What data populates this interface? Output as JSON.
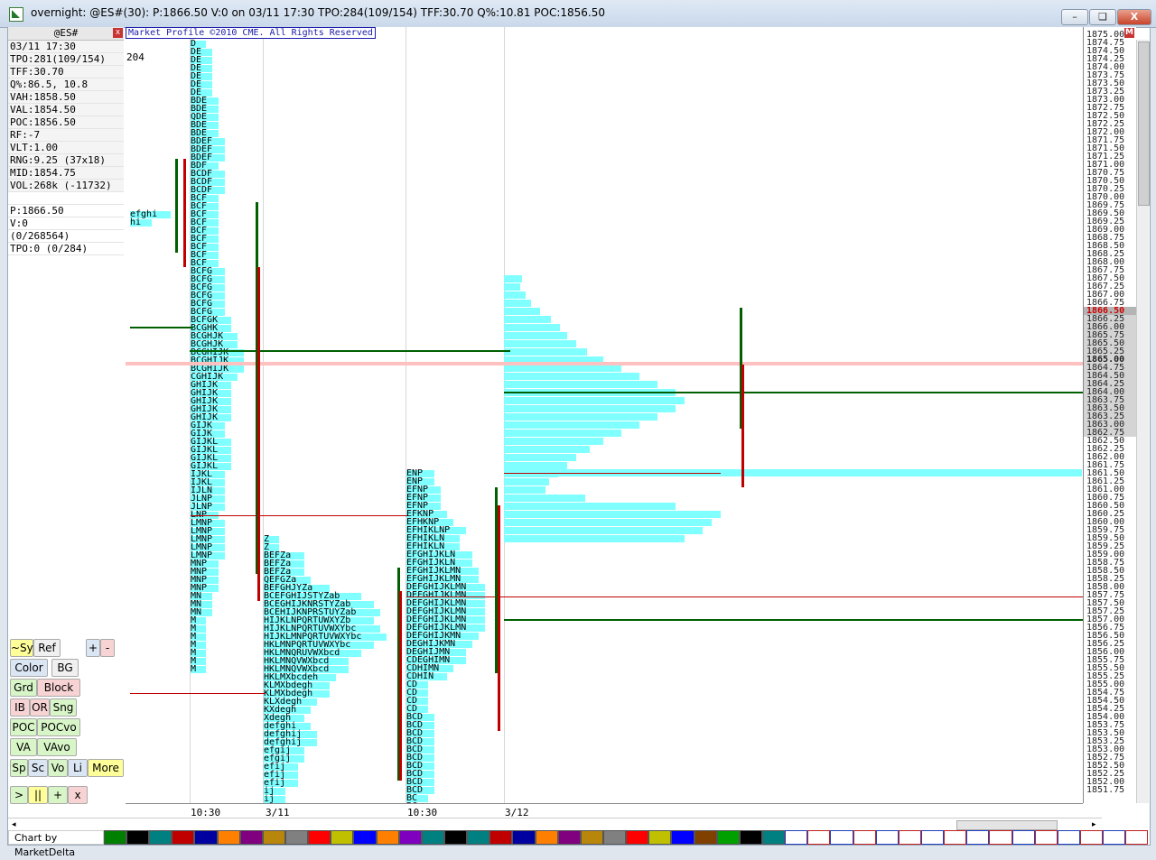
{
  "window": {
    "title": "overnight: @ES#(30): P:1866.50 V:0 on 03/11 17:30 TPO:284(109/154) TFF:30.70 Q%:10.81 POC:1856.50",
    "minimize": "–",
    "restore": "❏",
    "close": "X"
  },
  "info_panel": {
    "symbol": "@ES#",
    "close_mark": "x",
    "rows": [
      "03/11 17:30",
      "TPO:281(109/154)",
      "TFF:30.70",
      " Q%:86.5, 10.8",
      "VAH:1858.50",
      "VAL:1854.50",
      "POC:1856.50",
      "  RF:-7",
      "VLT:1.00",
      "RNG:9.25 (37x18)",
      "MID:1854.75",
      "VOL:268k (-11732)",
      "",
      "    P:1866.50",
      "   V:0",
      "     (0/268564)",
      "TPO:0 (0/284)"
    ],
    "tpo_overflow": "204"
  },
  "chart": {
    "copyright": "Market Profile ©2010 CME. All Rights Reserved",
    "right_mark": "M",
    "time_labels": [
      "10:30",
      "3/11",
      "10:30",
      "3/12"
    ],
    "current_price": "1866.50",
    "last_price_row": "1865.00",
    "price_ticks": [
      "1875.00",
      "1874.75",
      "1874.50",
      "1874.25",
      "1874.00",
      "1873.75",
      "1873.50",
      "1873.25",
      "1873.00",
      "1872.75",
      "1872.50",
      "1872.25",
      "1872.00",
      "1871.75",
      "1871.50",
      "1871.25",
      "1871.00",
      "1870.75",
      "1870.50",
      "1870.25",
      "1870.00",
      "1869.75",
      "1869.50",
      "1869.25",
      "1869.00",
      "1868.75",
      "1868.50",
      "1868.25",
      "1868.00",
      "1867.75",
      "1867.50",
      "1867.25",
      "1867.00",
      "1866.75",
      "1866.50",
      "1866.25",
      "1866.00",
      "1865.75",
      "1865.50",
      "1865.25",
      "1865.00",
      "1864.75",
      "1864.50",
      "1864.25",
      "1864.00",
      "1863.75",
      "1863.50",
      "1863.25",
      "1863.00",
      "1862.75",
      "1862.50",
      "1862.25",
      "1862.00",
      "1861.75",
      "1861.50",
      "1861.25",
      "1861.00",
      "1860.75",
      "1860.50",
      "1860.25",
      "1860.00",
      "1859.75",
      "1859.50",
      "1859.25",
      "1859.00",
      "1858.75",
      "1858.50",
      "1858.25",
      "1858.00",
      "1857.75",
      "1857.50",
      "1857.25",
      "1857.00",
      "1856.75",
      "1856.50",
      "1856.25",
      "1856.00",
      "1855.75",
      "1855.50",
      "1855.25",
      "1855.00",
      "1854.75",
      "1854.50",
      "1854.25",
      "1854.00",
      "1853.75",
      "1853.50",
      "1853.25",
      "1853.00",
      "1852.75",
      "1852.50",
      "1852.25",
      "1852.00",
      "1851.75"
    ],
    "profiles": [
      {
        "name": "profile-0310-night",
        "rows": [
          "efghi",
          "hi"
        ]
      },
      {
        "name": "profile-0310-day",
        "rows": [
          "D",
          "DE",
          "DE",
          "DE",
          "DE",
          "DE",
          "DE",
          "BDE",
          "BDE",
          "QDE",
          "BDE",
          "BDE",
          "BDEF",
          "BDEF",
          "BDEF",
          "BDF",
          "BCDF",
          "BCDF",
          "BCDF",
          "BCF",
          "BCF",
          "BCF",
          "BCF",
          "BCF",
          "BCF",
          "BCF",
          "BCF",
          "BCF",
          "BCFG",
          "BCFG",
          "BCFG",
          "BCFG",
          "BCFG",
          "BCFG",
          "BCFGK",
          "BCGHK",
          "BCGHJK",
          "BCGHJK",
          "BCGHIJK",
          "BCGHIJK",
          "BCGHIJK",
          "CGHIJK",
          "GHIJK",
          "GHIJK",
          "GHIJK",
          "GHIJK",
          "GHIJK",
          "GIJK",
          "GIJK",
          "GIJKL",
          "GIJKL",
          "GIJKL",
          "GIJKL",
          "IJKL",
          "IJKL",
          "IJLN",
          "JLNP",
          "JLNP",
          "LNP",
          "LMNP",
          "LMNP",
          "LMNP",
          "LMNP",
          "LMNP",
          "MNP",
          "MNP",
          "MNP",
          "MNP",
          "MN",
          "MN",
          "MN",
          "M",
          "M",
          "M",
          "M",
          "M",
          "M",
          "M"
        ]
      },
      {
        "name": "profile-0311-night",
        "rows": [
          "Z",
          "Z",
          "BEFZa",
          "BEFZa",
          "BEFZa",
          "QEFGZa",
          "BEFGHJYZa",
          "BCEFGHIJSTYZab",
          "BCEGHIJKNRSTYZab",
          "BCEHIJKNPRSTUYZab",
          "HIJKLNPQRTUWXYZb",
          "HIJKLNPQRTUVWXYbc",
          "HIJKLMNPQRTUVWXYbc",
          "HKLMNPQRTUVWXYbc",
          "HKLMNQRUVWXbcd",
          "HKLMNQVWXbcd",
          "HKLMNQVWXbcd",
          "HKLMXbcdeh",
          "KLMXbdegh",
          "KLMXbdegh",
          "KLXdegh",
          "KXdegh",
          "Xdegh",
          "defghi",
          "defghij",
          "defghij",
          "efgij",
          "efgij",
          "efij",
          "efij",
          "efij",
          "ij",
          "ij"
        ]
      },
      {
        "name": "profile-0311-day",
        "rows": [
          "ENP",
          "ENP",
          "EFNP",
          "EFNP",
          "EFNP",
          "EFKNP",
          "EFHKNP",
          "EFHIKLNP",
          "EFHIKLN",
          "EFHIKLN",
          "EFGHIJKLN",
          "EFGHIJKLN",
          "EFGHIJKLMN",
          "EFGHIJKLMN",
          "DEFGHIJKLMN",
          "DEFGHIJKLMN",
          "DEFGHIJKLMN",
          "DEFGHIJKLMN",
          "DEFGHIJKLMN",
          "DEFGHIJKLMN",
          "DEFGHIJKMN",
          "DEGHIJKMN",
          "DEGHIJMN",
          "CDEGHIMN",
          "CDHIMN",
          "CDHIN",
          "CD",
          "CD",
          "CD",
          "CD",
          "BCD",
          "BCD",
          "BCD",
          "BCD",
          "BCD",
          "BCD",
          "BCD",
          "BCD",
          "BCD",
          "BCD",
          "BC",
          "BC"
        ]
      }
    ]
  },
  "toolbar": {
    "rows": [
      [
        "~Sym",
        "Ref",
        "+",
        "-"
      ],
      [
        "Color",
        "BG"
      ],
      [
        "Grd",
        "Block"
      ],
      [
        "IB",
        "OR",
        "Sng"
      ],
      [
        "POC",
        "POCvo"
      ],
      [
        "VA",
        "VAvo"
      ],
      [
        "Sp",
        "Sc",
        "Vo",
        "Li",
        "More"
      ],
      [
        ">",
        "||",
        "+",
        "x"
      ]
    ]
  },
  "status": {
    "brand": "Chart by MarketDelta"
  },
  "palette_colors": [
    "#008000",
    "#000000",
    "#008080",
    "#c00000",
    "#0000a0",
    "#ff8000",
    "#800080",
    "#b8860b",
    "#808080",
    "#ff0000",
    "#c0c000",
    "#0000ff",
    "#ff8000",
    "#8000c0",
    "#008080",
    "#000000",
    "#008080",
    "#c00000",
    "#0000a0",
    "#ff8000",
    "#800080",
    "#b8860b",
    "#808080",
    "#ff0000",
    "#c0c000",
    "#0000ff",
    "#804000",
    "#00a000",
    "#000000",
    "#008080",
    "#ffffff",
    "#ffffff",
    "#ffffff",
    "#ffffff",
    "#ffffff",
    "#ffffff",
    "#ffffff",
    "#ffffff",
    "#ffffff",
    "#ffffff",
    "#ffffff",
    "#ffffff",
    "#ffffff",
    "#ffffff",
    "#ffffff",
    "#ffffff"
  ]
}
